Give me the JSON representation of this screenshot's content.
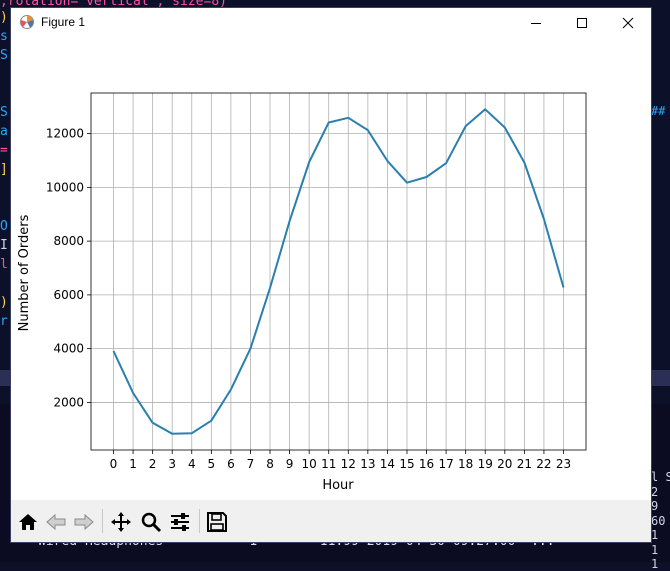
{
  "background": {
    "top_code": ",rotation='vertical', size=8)",
    "left_chars": [
      ")",
      "s",
      "S",
      "",
      "",
      "S",
      "a",
      "=",
      "]",
      "",
      "",
      "O",
      "I",
      "l",
      "",
      ")",
      "r"
    ],
    "right_chars": [
      "##"
    ],
    "terminal_right_chars": [
      "l S",
      "2",
      "9",
      "60",
      "1",
      "1",
      "1"
    ],
    "terminal_rows": [
      "Wired Headphones           1        11.99 2019-04-30 09:27:00  ..."
    ]
  },
  "window": {
    "title": "Figure 1",
    "controls": {
      "minimize_icon": "minimize-icon",
      "maximize_icon": "maximize-icon",
      "close_icon": "close-icon"
    }
  },
  "toolbar": {
    "buttons": [
      {
        "name": "home-button",
        "icon": "home-icon"
      },
      {
        "name": "back-button",
        "icon": "back-arrow-icon"
      },
      {
        "name": "forward-button",
        "icon": "forward-arrow-icon"
      },
      {
        "name": "pan-button",
        "icon": "pan-move-icon"
      },
      {
        "name": "zoom-button",
        "icon": "zoom-magnifier-icon"
      },
      {
        "name": "configure-subplots-button",
        "icon": "sliders-icon"
      },
      {
        "name": "save-button",
        "icon": "save-floppy-icon"
      }
    ]
  },
  "colors": {
    "line": "#2a7fae",
    "grid": "#b0b0b0",
    "toolbar_bg": "#f0f0f0"
  },
  "chart_data": {
    "type": "line",
    "title": "",
    "xlabel": "Hour",
    "ylabel": "Number of Orders",
    "x": [
      0,
      1,
      2,
      3,
      4,
      5,
      6,
      7,
      8,
      9,
      10,
      11,
      12,
      13,
      14,
      15,
      16,
      17,
      18,
      19,
      20,
      21,
      22,
      23
    ],
    "series": [
      {
        "values": [
          3910,
          2350,
          1243,
          831,
          854,
          1321,
          2482,
          4011,
          6256,
          8748,
          10944,
          12411,
          12587,
          12129,
          10984,
          10175,
          10384,
          10899,
          12280,
          12905,
          12228,
          10921,
          8822,
          6275
        ]
      }
    ],
    "xticks": [
      "0",
      "1",
      "2",
      "3",
      "4",
      "5",
      "6",
      "7",
      "8",
      "9",
      "10",
      "11",
      "12",
      "13",
      "14",
      "15",
      "16",
      "17",
      "18",
      "19",
      "20",
      "21",
      "22",
      "23"
    ],
    "yticks": [
      2000,
      4000,
      6000,
      8000,
      10000,
      12000
    ],
    "ytick_labels": [
      "2000",
      "4000",
      "6000",
      "8000",
      "10000",
      "12000"
    ],
    "xlim": [
      -1.15,
      24.15
    ],
    "ylim": [
      230,
      13510
    ],
    "grid": true
  }
}
